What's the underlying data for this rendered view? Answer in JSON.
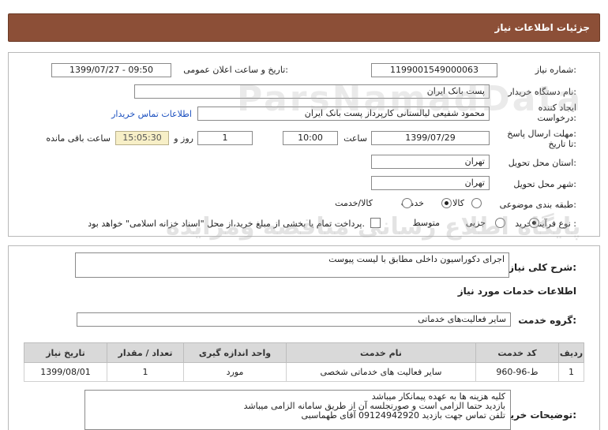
{
  "header": {
    "title": "جزئیات اطلاعات نیاز"
  },
  "fields": {
    "need_number_label": "شماره نیاز:",
    "need_number": "1199001549000063",
    "announce_label": "تاریخ و ساعت اعلان عمومی:",
    "announce_value": "1399/07/27 - 09:50",
    "buyer_label": "نام دستگاه خریدار:",
    "buyer_value": "پست بانک ایران",
    "creator_label_1": "ایجاد کننده",
    "creator_label_2": "درخواست:",
    "creator_value": "محمود شفیعی لیالستانی کارپرداز پست بانک ایران",
    "contact_link": "اطلاعات تماس خریدار",
    "deadline_label_1": "مهلت ارسال پاسخ:",
    "deadline_label_2": "تا تاریخ:",
    "deadline_date": "1399/07/29",
    "time_label": "ساعت",
    "deadline_time": "10:00",
    "days_value": "1",
    "days_label": "روز و",
    "remaining_time": "15:05:30",
    "remaining_label": "ساعت باقی مانده",
    "province_label": "استان محل تحویل:",
    "province_value": "تهران",
    "city_label": "شهر محل تحویل:",
    "city_value": "تهران",
    "category_label": "طبقه بندی موضوعی:",
    "category_options": [
      "کالا",
      "خدمت",
      "کالا/خدمت"
    ],
    "process_label": "نوع فرآیند خرید :",
    "process_options": [
      "جزیی",
      "متوسط"
    ],
    "payment_note": "پرداخت تمام یا بخشی از مبلغ خرید،از محل \"اسناد خزانه اسلامی\" خواهد بود."
  },
  "summary": {
    "label": "شرح کلی نیاز:",
    "value": "اجرای دکوراسیون داخلی مطابق با لیست پیوست"
  },
  "services": {
    "section_title": "اطلاعات خدمات مورد نیاز",
    "group_label": "گروه خدمت:",
    "group_value": "سایر فعالیت‌های خدماتی",
    "columns": [
      "ردیف",
      "کد خدمت",
      "نام خدمت",
      "واحد اندازه گیری",
      "تعداد / مقدار",
      "تاریخ نیاز"
    ],
    "rows": [
      [
        "1",
        "ط-96-960",
        "سایر فعالیت های خدماتی شخصی",
        "مورد",
        "1",
        "1399/08/01"
      ]
    ]
  },
  "buyer_notes": {
    "label": "توضیحات خریدار:",
    "lines": [
      "کلیه هزینه ها به عهده پیمانکار میباشد",
      "بازدید حتما الزامی است و صورتجلسه آن از طریق سامانه الزامی میباشد",
      "تلفن تماس جهت بازدید 09124942920 آقای طهماسبی"
    ]
  },
  "watermark": {
    "text_1": "ParsNamadData",
    "text_2": "پایگاه اطلاع رسانی مناقصه ومزایده"
  }
}
